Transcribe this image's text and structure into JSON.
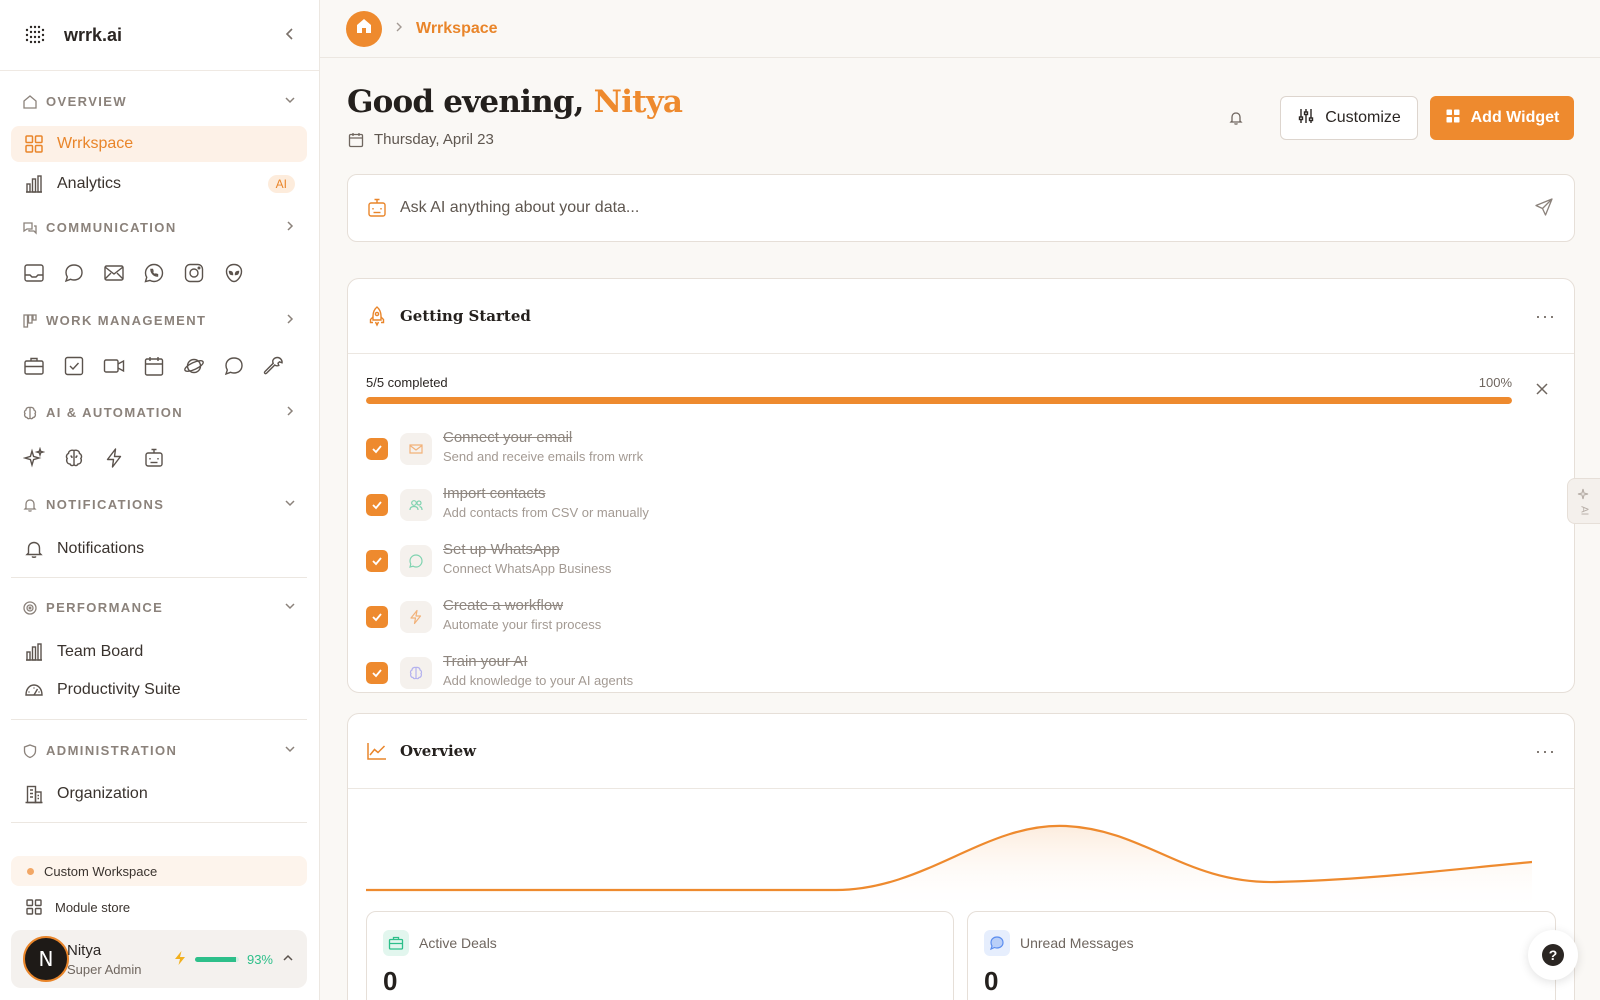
{
  "brand": {
    "name": "wrrk.ai"
  },
  "sidebar": {
    "overview": {
      "title": "OVERVIEW",
      "items": [
        {
          "label": "Wrrkspace",
          "icon": "grid-icon",
          "active": true
        },
        {
          "label": "Analytics",
          "icon": "bar-chart-icon",
          "badge": "AI"
        }
      ]
    },
    "communication": {
      "title": "COMMUNICATION",
      "icons": [
        "inbox-icon",
        "chat-bubble-icon",
        "mail-icon",
        "whatsapp-icon",
        "instagram-icon",
        "alien-icon"
      ]
    },
    "work_management": {
      "title": "WORK MANAGEMENT",
      "icons": [
        "briefcase-icon",
        "checkbox-icon",
        "video-icon",
        "calendar-icon",
        "planet-icon",
        "message-icon",
        "wrench-icon"
      ]
    },
    "ai_automation": {
      "title": "AI & AUTOMATION",
      "icons": [
        "sparkle-icon",
        "brain-icon",
        "lightning-icon",
        "robot-icon"
      ]
    },
    "notifications": {
      "title": "NOTIFICATIONS",
      "items": [
        {
          "label": "Notifications",
          "icon": "bell-icon"
        }
      ]
    },
    "performance": {
      "title": "PERFORMANCE",
      "items": [
        {
          "label": "Team Board",
          "icon": "bar-chart-icon"
        },
        {
          "label": "Productivity Suite",
          "icon": "gauge-icon"
        }
      ]
    },
    "administration": {
      "title": "ADMINISTRATION",
      "items": [
        {
          "label": "Organization",
          "icon": "building-icon"
        }
      ]
    },
    "workspace": "Custom Workspace",
    "module_store": "Module store",
    "user": {
      "initial": "N",
      "name": "Nitya",
      "role": "Super Admin",
      "score": "93%",
      "score_value": 0.93
    }
  },
  "topbar": {
    "breadcrumb": "Wrrkspace"
  },
  "header": {
    "greeting_prefix": "Good evening, ",
    "greeting_name": "Nitya",
    "date": "Thursday, April 23",
    "customize_label": "Customize",
    "add_widget_label": "Add Widget"
  },
  "ask": {
    "placeholder": "Ask AI anything about your data..."
  },
  "getting_started": {
    "title": "Getting Started",
    "progress_text": "5/5 completed",
    "progress_pct": "100%",
    "progress_value": 1.0,
    "tasks": [
      {
        "title": "Connect your email",
        "desc": "Send and receive emails from wrrk",
        "icon": "mail-icon",
        "color": "#f2b27a"
      },
      {
        "title": "Import contacts",
        "desc": "Add contacts from CSV or manually",
        "icon": "users-icon",
        "color": "#7fd3b0"
      },
      {
        "title": "Set up WhatsApp",
        "desc": "Connect WhatsApp Business",
        "icon": "whatsapp-icon",
        "color": "#7fd3b0"
      },
      {
        "title": "Create a workflow",
        "desc": "Automate your first process",
        "icon": "lightning-icon",
        "color": "#f2b27a"
      },
      {
        "title": "Train your AI",
        "desc": "Add knowledge to your AI agents",
        "icon": "brain-icon",
        "color": "#b4b2ee"
      }
    ]
  },
  "overview": {
    "title": "Overview",
    "stats": [
      {
        "label": "Active Deals",
        "value": "0",
        "icon": "briefcase-icon",
        "color": "#2dbf8a"
      },
      {
        "label": "Unread Messages",
        "value": "0",
        "icon": "message-icon",
        "color": "#5b8def"
      }
    ]
  },
  "side_tab": {
    "label": "AI"
  },
  "colors": {
    "accent": "#ee8a2e",
    "accent_light": "#fdf1e7",
    "success": "#2dbf8a"
  }
}
